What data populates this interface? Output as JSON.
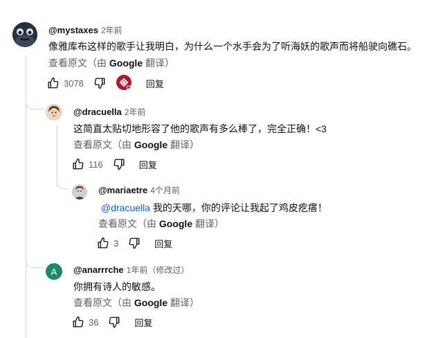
{
  "comments": [
    {
      "handle": "@mystaxes",
      "time": "2年前",
      "text": "像雅库布这样的歌手让我明白，为什么一个水手会为了听海妖的歌声而将船驶向礁石。",
      "translate_prefix": "查看原文（由 ",
      "translate_brand": "Google",
      "translate_suffix": " 翻译）",
      "likes": "3078",
      "reply_label": "回复"
    },
    {
      "handle": "@dracuella",
      "time": "2年前",
      "text": "这简直太贴切地形容了他的歌声有多么棒了，完全正确！<3",
      "translate_prefix": "查看原文（由 ",
      "translate_brand": "Google",
      "translate_suffix": " 翻译）",
      "likes": "116",
      "reply_label": "回复"
    },
    {
      "handle": "@mariaetre",
      "time": "4个月前",
      "mention": "@dracuella",
      "text": " 我的天哪，你的评论让我起了鸡皮疙瘩！",
      "translate_prefix": "查看原文（由 ",
      "translate_brand": "Google",
      "translate_suffix": " 翻译）",
      "likes": "3",
      "reply_label": "回复"
    },
    {
      "handle": "@anarrrche",
      "time": "1年前（修改过）",
      "avatar_letter": "A",
      "avatar_color": "#1a8a6e",
      "text": "你拥有诗人的敏感。",
      "translate_prefix": "查看原文（由 ",
      "translate_brand": "Google",
      "translate_suffix": " 翻译）",
      "likes": "36",
      "reply_label": "回复"
    }
  ],
  "colors": {
    "creator_heart_bg": "#b5152b",
    "heart": "#e62117"
  }
}
